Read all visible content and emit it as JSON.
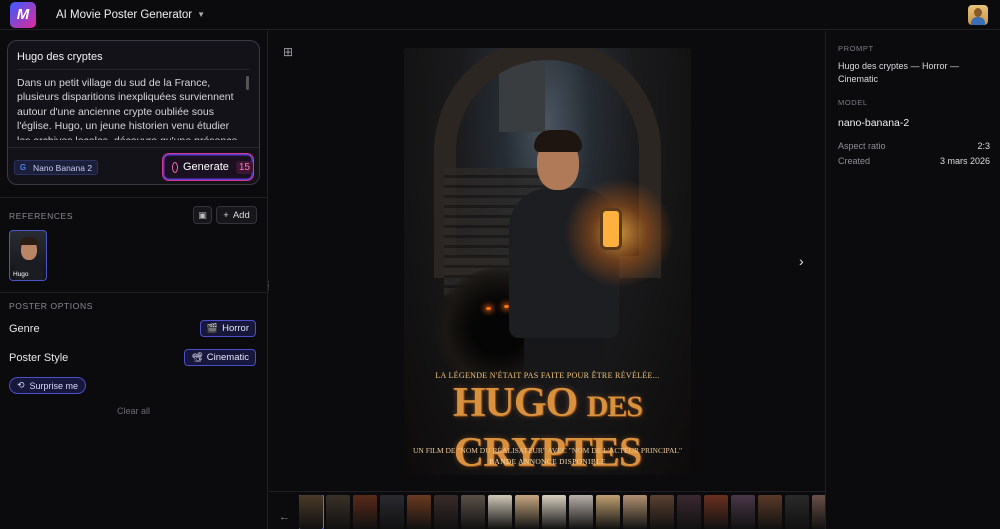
{
  "app": {
    "title": "AI Movie Poster Generator"
  },
  "prompt": {
    "title": "Hugo des cryptes",
    "text": "Dans un petit village du sud de la France, plusieurs disparitions inexpliquées surviennent autour d'une ancienne crypte oubliée sous l'église. Hugo, un jeune historien venu étudier les archives locales, découvre qu'une présence",
    "model_chip": "Nano Banana 2",
    "generate_label": "Generate",
    "generate_count": "15"
  },
  "references": {
    "label": "REFERENCES",
    "add_label": "Add",
    "items": [
      {
        "name": "Hugo"
      }
    ]
  },
  "options": {
    "label": "POSTER OPTIONS",
    "genre_label": "Genre",
    "genre_value": "Horror",
    "style_label": "Poster Style",
    "style_value": "Cinematic",
    "surprise_label": "Surprise me",
    "clear_label": "Clear all"
  },
  "poster": {
    "tagline": "LA LÉGENDE N'ÉTAIT PAS FAITE POUR ÊTRE RÉVÉLÉE...",
    "title_main1": "HUGO",
    "title_small": "DES",
    "title_main2": "CRYPTES",
    "credits": "UN FILM DE \"NOM DU RÉALISATEUR\" AVEC \"NOM DE L'ACTEUR PRINCIPAL\"",
    "credits2": "BANDE ANNONCE DISPONIBLE"
  },
  "details": {
    "prompt_label": "PROMPT",
    "prompt_value": "Hugo des cryptes — Horror — Cinematic",
    "model_label": "MODEL",
    "model_value": "nano-banana-2",
    "aspect_label": "Aspect ratio",
    "aspect_value": "2:3",
    "created_label": "Created",
    "created_value": "3 mars 2026"
  },
  "filmstrip": {
    "colors": [
      "#4a3a2a",
      "#3a3028",
      "#5a2a1a",
      "#2a2a30",
      "#6a3a20",
      "#3a2a2a",
      "#5a5048",
      "#d0c8b8",
      "#c8a880",
      "#d8d0c0",
      "#b8b0a8",
      "#c0a070",
      "#b09070",
      "#5a4030",
      "#3a2830",
      "#6a3020",
      "#4a3848",
      "#5a3a28",
      "#2a2a2a",
      "#6a5048",
      "#c0b8a8",
      "#4a3020"
    ]
  },
  "colors": {
    "accent": "#4b4fc9",
    "generate_border": "#d4378f",
    "background": "#0b0b0d"
  }
}
